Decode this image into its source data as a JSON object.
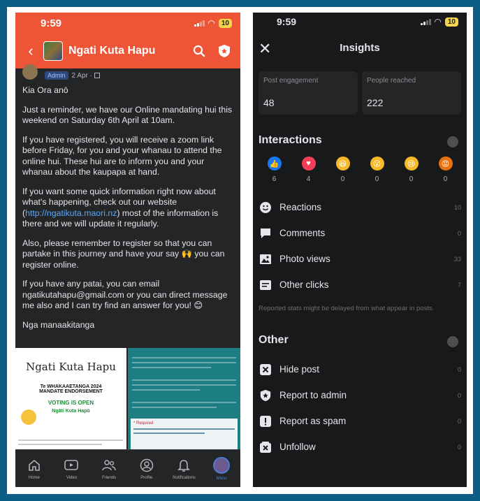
{
  "left": {
    "status_time": "9:59",
    "battery": "10",
    "group_name": "Ngati Kuta Hapu",
    "meta_role": "Admin",
    "meta_date": "2 Apr ·",
    "paragraphs": [
      "Kia Ora anō",
      "Just a reminder, we have our Online mandating hui this weekend on Saturday 6th April at 10am.",
      "If you have registered, you will receive a zoom link before Friday, for you and your whanau to attend the online hui. These hui are to inform you and your whanau about the kaupapa at hand.",
      "Also, please remember to register so that you can partake in this journey and have your say 🙌 you can register online.",
      "Nga manaakitanga"
    ],
    "para3_prefix": "If you want some quick information right now about what's happening, check out our website (",
    "para3_link": "http://ngatikuta.maori.nz",
    "para3_suffix": ") most of the information is there and we will update it regularly.",
    "para5": "If you have any patai, you can email ngatikutahapu@gmail.com or you can direct message me also and I can try find an answer for you! 😊",
    "image1": {
      "title": "Ngati Kuta Hapu",
      "line1": "Te WHAKAAETANGA 2024",
      "line2": "MANDATE ENDORSEMENT",
      "line3": "VOTING IS OPEN",
      "line4": "Ngāti Kuta Hapū"
    },
    "image2": {
      "label": "* Required"
    },
    "tabs": [
      {
        "label": "Home",
        "icon": "home-icon"
      },
      {
        "label": "Video",
        "icon": "video-icon"
      },
      {
        "label": "Friends",
        "icon": "friends-icon"
      },
      {
        "label": "Profile",
        "icon": "profile-icon"
      },
      {
        "label": "Notifications",
        "icon": "bell-icon"
      },
      {
        "label": "Menu",
        "icon": "menu-avatar"
      }
    ]
  },
  "right": {
    "status_time": "9:59",
    "battery": "10",
    "title": "Insights",
    "cards": [
      {
        "label": "Post engagement",
        "value": "48"
      },
      {
        "label": "People reached",
        "value": "222"
      }
    ],
    "interactions_title": "Interactions",
    "reactions": [
      {
        "name": "like",
        "count": "6",
        "color": "#1877f2",
        "glyph": "👍"
      },
      {
        "name": "love",
        "count": "4",
        "color": "#f33e58",
        "glyph": "♥"
      },
      {
        "name": "haha",
        "count": "0",
        "color": "#f7b928",
        "glyph": "😆"
      },
      {
        "name": "wow",
        "count": "0",
        "color": "#f7b928",
        "glyph": "😮"
      },
      {
        "name": "sad",
        "count": "0",
        "color": "#f7b928",
        "glyph": "😢"
      },
      {
        "name": "angry",
        "count": "0",
        "color": "#e9710f",
        "glyph": "😡"
      }
    ],
    "interaction_rows": [
      {
        "label": "Reactions",
        "value": "10",
        "icon": "smiley-icon"
      },
      {
        "label": "Comments",
        "value": "0",
        "icon": "comment-icon"
      },
      {
        "label": "Photo views",
        "value": "33",
        "icon": "photo-icon"
      },
      {
        "label": "Other clicks",
        "value": "7",
        "icon": "clicks-icon"
      }
    ],
    "note": "Reported stats might be delayed from what appear in posts.",
    "other_title": "Other",
    "other_rows": [
      {
        "label": "Hide post",
        "value": "0",
        "icon": "hide-icon"
      },
      {
        "label": "Report to admin",
        "value": "0",
        "icon": "shield-icon"
      },
      {
        "label": "Report as spam",
        "value": "0",
        "icon": "spam-icon"
      },
      {
        "label": "Unfollow",
        "value": "0",
        "icon": "unfollow-icon"
      }
    ]
  }
}
